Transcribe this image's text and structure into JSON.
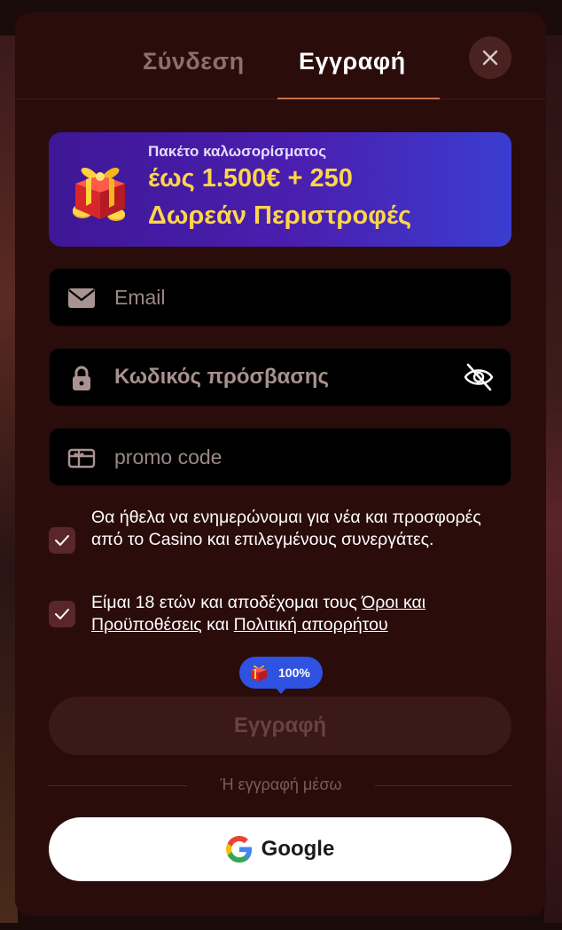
{
  "tabs": {
    "login_label": "Σύνδεση",
    "register_label": "Εγγραφή",
    "active": "register"
  },
  "banner": {
    "subtitle": "Πακέτο καλωσορίσματος",
    "line1": "έως 1.500€ + 250",
    "line2": "Δωρεάν Περιστροφές"
  },
  "form": {
    "email_placeholder": "Email",
    "password_placeholder": "Κωδικός πρόσβασης",
    "promo_placeholder": "promo code"
  },
  "consents": {
    "newsletter": {
      "checked": true,
      "text": "Θα ήθελα να ενημερώνομαι για νέα και προσφορές από το Casino και επιλεγμένους συνεργάτες."
    },
    "terms": {
      "checked": true,
      "text_before": "Είμαι 18 ετών και αποδέχομαι τους ",
      "terms_link": "Όροι και Προϋποθέσεις",
      "text_middle": " και ",
      "privacy_link": "Πολιτική απορρήτου"
    }
  },
  "progress_badge": {
    "icon": "gift-icon",
    "text": "100%"
  },
  "submit_label": "Εγγραφή",
  "divider_text": "Ή εγγραφή μέσω",
  "google_label": "Google",
  "colors": {
    "modal_bg": "#2a0c0b",
    "accent_underline": "#c9704e",
    "banner_highlight": "#ffd54a",
    "badge_blue": "#2f52e0"
  }
}
